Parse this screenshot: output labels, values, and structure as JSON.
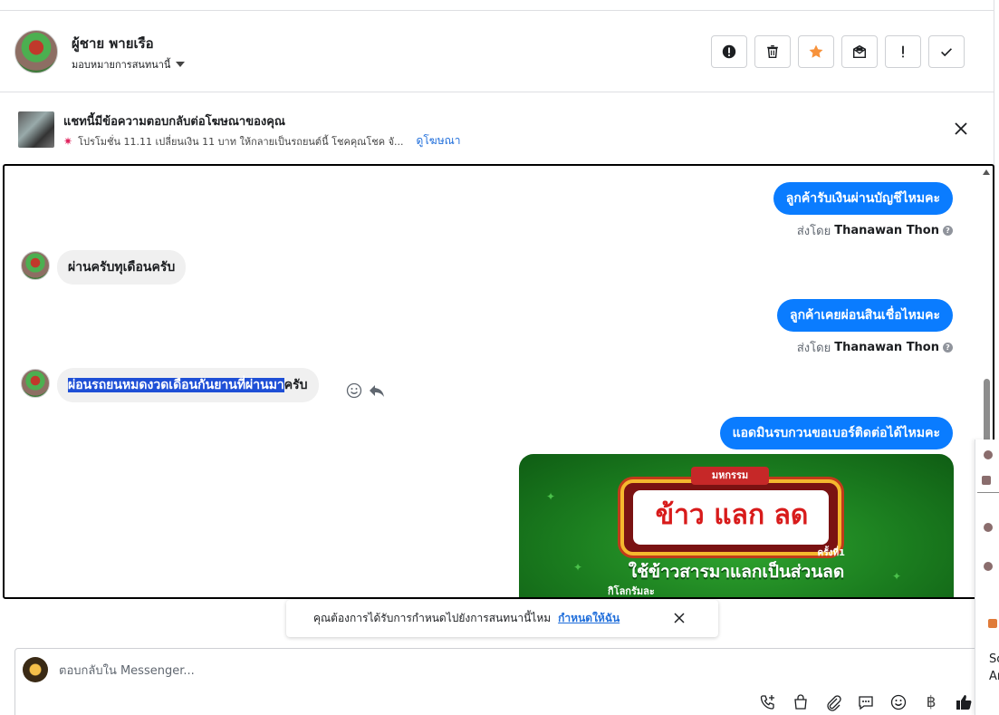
{
  "header": {
    "contact_name": "ผู้ชาย พายเรือ",
    "assign_label": "มอบหมายการสนทนานี้",
    "toolbar": [
      {
        "icon": "alert-circle-icon"
      },
      {
        "icon": "trash-icon"
      },
      {
        "icon": "star-icon",
        "color": "#f7923b"
      },
      {
        "icon": "mark-unread-icon"
      },
      {
        "icon": "exclamation-icon"
      },
      {
        "icon": "check-icon"
      }
    ]
  },
  "ad_banner": {
    "title": "แชทนี้มีข้อความตอบกลับต่อโฆษณาของคุณ",
    "subtitle": "โปรโมชั่น 11.11 เปลี่ยนเงิน 11 บาท ให้กลายเป็นรถยนต์นี้ โชคคุณโชค จั...",
    "link": "ดูโฆษณา"
  },
  "messages": [
    {
      "direction": "out",
      "text": "ลูกค้ารับเงินผ่านบัญชีไหมคะ",
      "sent_by_prefix": "ส่งโดย",
      "sent_by_name": "Thanawan Thon"
    },
    {
      "direction": "in",
      "text": "ผ่านครับทุเดือนครับ"
    },
    {
      "direction": "out",
      "text": "ลูกค้าเคยผ่อนสินเชื่อไหมคะ",
      "sent_by_prefix": "ส่งโดย",
      "sent_by_name": "Thanawan Thon"
    },
    {
      "direction": "in",
      "text_selected": "ผ่อนรถยนหมดงวดเดือนกันยานที่ผ่านมา",
      "text_rest": "ครับ"
    },
    {
      "direction": "out",
      "text": "แอดมินรบกวนขอเบอร์ติดต่อได้ไหมคะ"
    }
  ],
  "promo_image": {
    "tag": "มหกรรม",
    "headline": "ข้าว แลก ลด",
    "note": "ครั้งที่1",
    "subline": "ใช้ข้าวสารมาแลกเป็นส่วนลด",
    "footer": "กิโลกรัมละ"
  },
  "assign_toast": {
    "text": "คุณต้องการได้รับการกำหนดไปยังการสนทนานี้ไหม",
    "link": "กำหนดให้ฉัน"
  },
  "reply": {
    "placeholder": "ตอบกลับใน Messenger...",
    "tools": [
      "phone-add-icon",
      "shopping-bag-icon",
      "paperclip-icon",
      "chat-bubble-icon",
      "emoji-icon",
      "baht-icon",
      "thumbs-up-icon"
    ],
    "baht_symbol": "฿"
  },
  "side_panel": {
    "line1": "Sc",
    "line2": "Ar"
  },
  "colors": {
    "accent": "#0a7cff",
    "link": "#216fdb",
    "selection": "#1e4fd6"
  }
}
